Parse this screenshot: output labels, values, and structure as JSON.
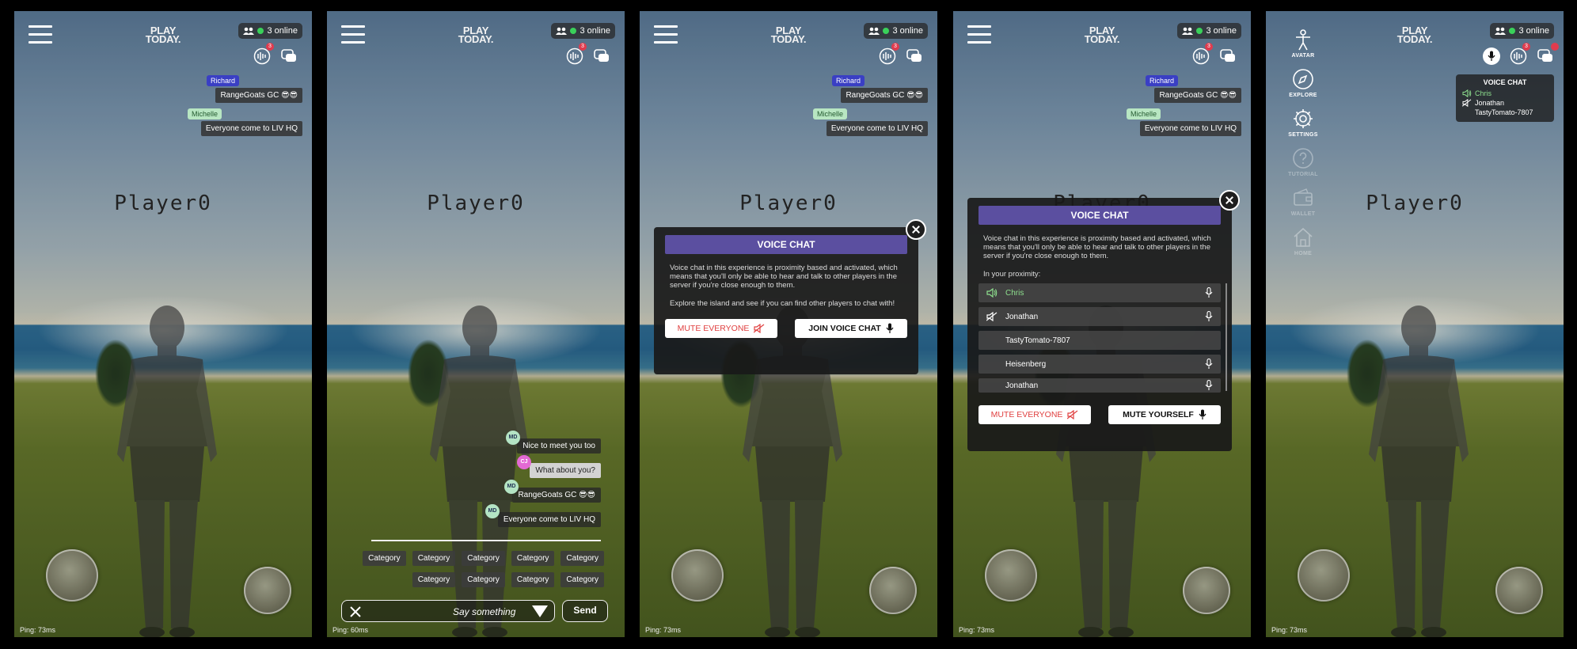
{
  "hud": {
    "logo_line1": "PLAY",
    "logo_line2": "TODAY.",
    "online": "3 online",
    "voice_badge": "3",
    "ping_a": "Ping: 73ms",
    "ping_b": "Ping: 60ms",
    "player_name": "Player0"
  },
  "overlay_chat": [
    {
      "user": "Richard",
      "message": "RangeGoats GC 😎😎"
    },
    {
      "user": "Michelle",
      "message": "Everyone come to LIV HQ"
    }
  ],
  "chat_panel": {
    "messages": [
      {
        "initials": "MD",
        "text": "Nice to meet you too"
      },
      {
        "initials": "CJ",
        "text": "What about you?"
      },
      {
        "initials": "MD",
        "text": "RangeGoats GC 😎😎"
      },
      {
        "initials": "MD",
        "text": "Everyone come to LIV HQ"
      }
    ],
    "categories": [
      "Category",
      "Category",
      "Category",
      "Category",
      "Category",
      "Category",
      "Category",
      "Category",
      "Category"
    ],
    "placeholder": "Say something",
    "send_label": "Send"
  },
  "voice_modal": {
    "title": "VOICE CHAT",
    "body1": "Voice chat in this experience is proximity based and activated, which means that you'll only be able to hear and talk to other players in the server if you're close enough to them.",
    "body2": "Explore the island and see if you can find other players to chat with!",
    "mute_everyone": "MUTE EVERYONE",
    "join_voice": "JOIN VOICE CHAT",
    "mute_yourself": "MUTE YOURSELF",
    "proximity_label": "In your proximity:",
    "players": [
      {
        "name": "Chris",
        "state": "speaking"
      },
      {
        "name": "Jonathan",
        "state": "muted"
      },
      {
        "name": "TastyTomato-7807",
        "state": "none"
      },
      {
        "name": "Heisenberg",
        "state": "none"
      },
      {
        "name": "Jonathan",
        "state": "none"
      }
    ]
  },
  "side_nav": [
    {
      "label": "AVATAR",
      "icon": "avatar-icon"
    },
    {
      "label": "EXPLORE",
      "icon": "compass-icon"
    },
    {
      "label": "SETTINGS",
      "icon": "gear-icon"
    },
    {
      "label": "TUTORIAL",
      "icon": "help-icon"
    },
    {
      "label": "WALLET",
      "icon": "wallet-icon"
    },
    {
      "label": "HOME",
      "icon": "home-icon"
    }
  ],
  "voice_mini": {
    "title": "VOICE CHAT",
    "p1": "Chris",
    "p2": "Jonathan",
    "p3": "TastyTomato-7807"
  },
  "colors": {
    "accent": "#5b4fa0",
    "online": "#3ad15a",
    "speaking": "#8ee08e",
    "badge": "#e03b4e"
  }
}
